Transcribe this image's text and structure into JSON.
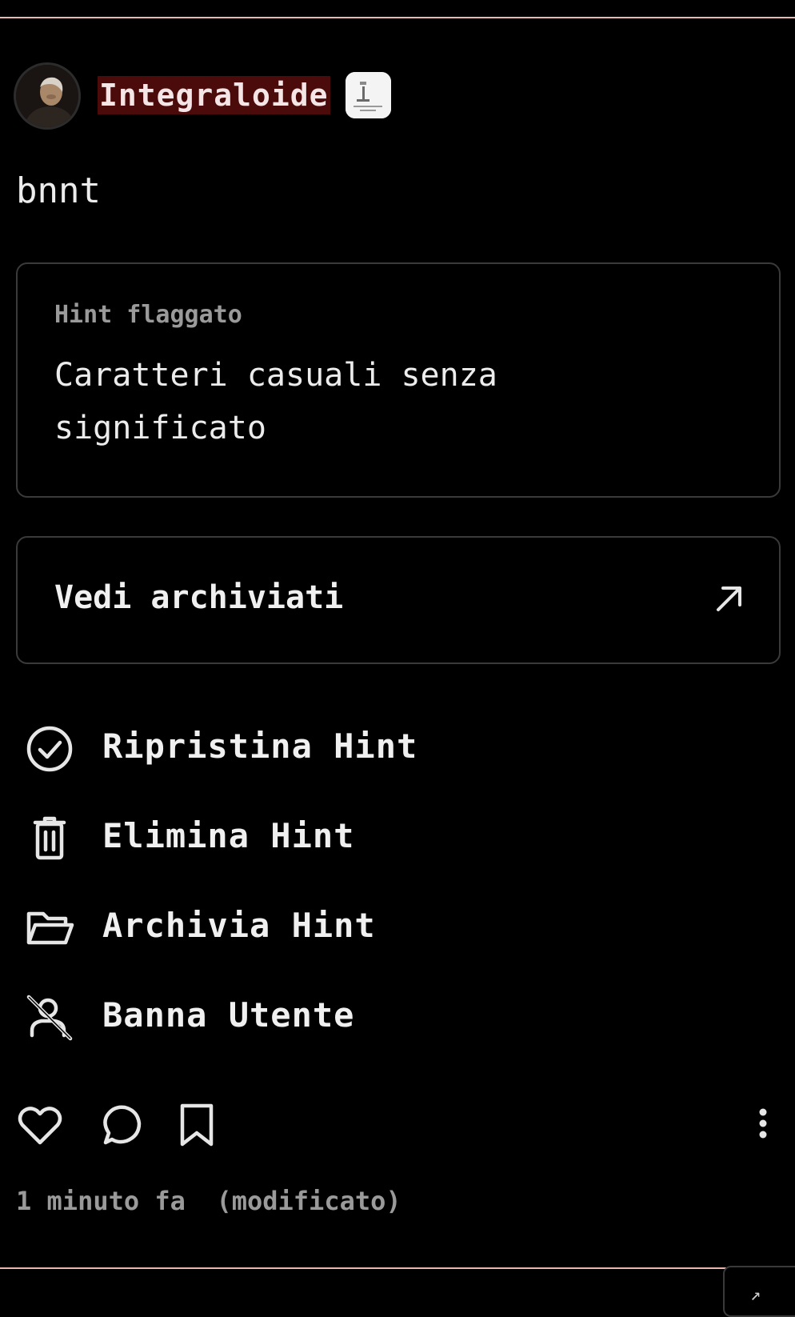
{
  "post": {
    "username": "Integraloide",
    "text": "bnnt"
  },
  "hint_card": {
    "label": "Hint flaggato",
    "text": "Caratteri casuali senza significato"
  },
  "archived_link": {
    "label": "Vedi archiviati",
    "icon": "arrow-up-right-icon"
  },
  "actions": [
    {
      "label": "Ripristina Hint",
      "icon": "check-circle-icon"
    },
    {
      "label": "Elimina Hint",
      "icon": "trash-icon"
    },
    {
      "label": "Archivia Hint",
      "icon": "folder-open-icon"
    },
    {
      "label": "Banna Utente",
      "icon": "user-off-icon"
    }
  ],
  "footer": {
    "icons": [
      "heart-icon",
      "comment-icon",
      "bookmark-icon",
      "more-vertical-icon"
    ],
    "timestamp": "1 minuto fa",
    "edited": "(modificato)"
  },
  "colors": {
    "background": "#000000",
    "divider": "#e8b7b0",
    "username_highlight": "#4b0b0b",
    "card_border": "#3a3a3a",
    "muted_text": "#9a9a9a"
  }
}
